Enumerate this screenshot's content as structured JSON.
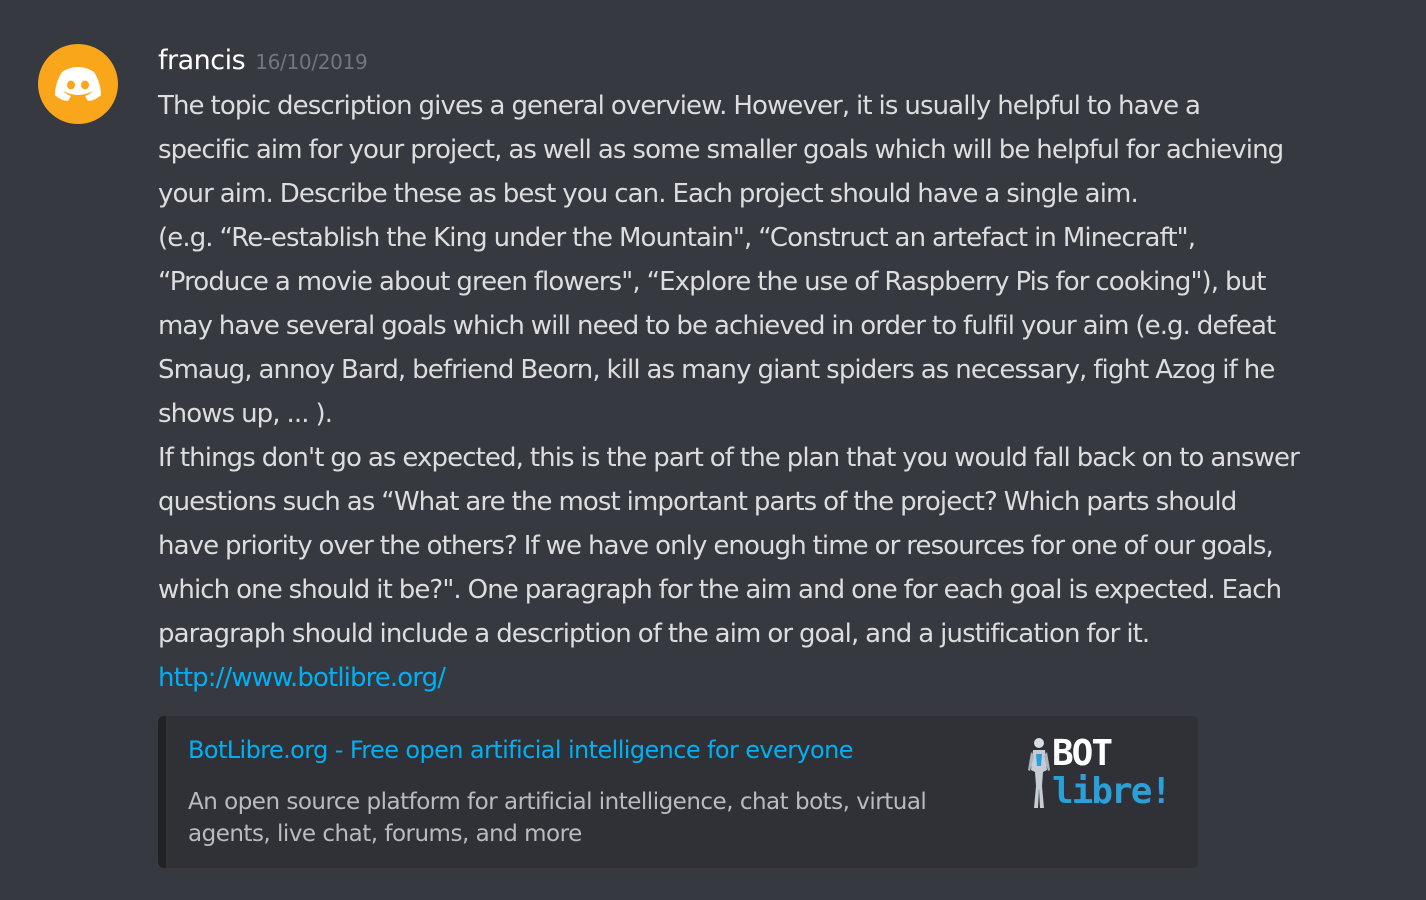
{
  "message": {
    "username": "francis",
    "timestamp": "16/10/2019",
    "lines": [
      "The topic description gives a general overview. However, it is usually helpful to have a",
      "specific aim for your project, as well as some smaller goals which will be helpful for achieving",
      "your aim. Describe these as best you can. Each project should have a single aim.",
      "(e.g. “Re-establish the King under the Mountain\", “Construct an artefact in Minecraft\",",
      "“Produce a movie about green flowers\", “Explore the use of Raspberry Pis for cooking\"), but",
      "may have several goals which will need to be achieved in order to fulfil your aim (e.g. defeat",
      "Smaug, annoy Bard, befriend Beorn, kill as many giant spiders as necessary, fight Azog if he",
      "shows up, ... ).",
      "If things don't go as expected, this is the part of the plan that you would fall back on to answer",
      "questions such as “What are the most important parts of the project? Which parts should",
      "have priority over the others? If we have only enough time or resources for one of our goals,",
      "which one should it be?\". One paragraph for the aim and one for each goal is expected. Each",
      "paragraph should include a description of the aim or goal, and a justification for it."
    ],
    "link": "http://www.botlibre.org/"
  },
  "embed": {
    "title": "BotLibre.org - Free open artificial intelligence for everyone",
    "description_lines": [
      "An open source platform for artificial intelligence, chat bots, virtual",
      "agents, live chat, forums, and more"
    ],
    "logo_top": "BOT",
    "logo_bottom": "libre!"
  },
  "icons": {
    "avatar": "discord-logo-icon",
    "logo_figure": "robot-figure-icon"
  },
  "colors": {
    "background": "#36393f",
    "avatar": "#faa61a",
    "link": "#00b0f4",
    "embed_background": "#2f3136",
    "username": "#ffffff",
    "timestamp": "#72767d"
  }
}
